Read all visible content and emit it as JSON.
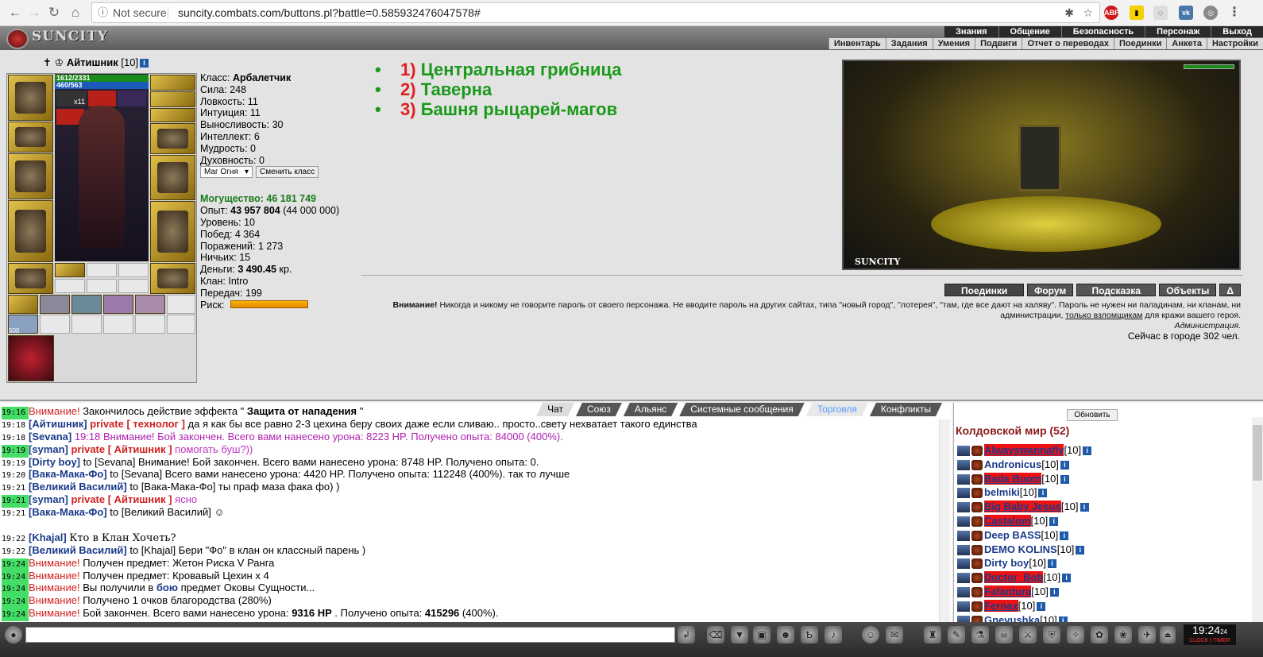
{
  "browser": {
    "not_secure": "Not secure",
    "url": "suncity.combats.com/buttons.pl?battle=0.585932476047578#"
  },
  "header": {
    "logo": "SUNCITY",
    "top_menu": [
      "Знания",
      "Общение",
      "Безопасность",
      "Персонаж",
      "Выход"
    ],
    "sub_menu": [
      "Инвентарь",
      "Задания",
      "Умения",
      "Подвиги",
      "Отчет о переводах",
      "Поединки",
      "Анкета",
      "Настройки"
    ]
  },
  "character": {
    "name": "Айтишник",
    "level": "[10]",
    "info_icon": "i",
    "hp": "1612/2331",
    "mana": "460/563",
    "buff_count": "x11",
    "slot_count": "500"
  },
  "stats": {
    "class_label": "Класс:",
    "class_value": "Арбалетчик",
    "lines": [
      "Сила: 248",
      "Ловкость: 11",
      "Интуиция: 11",
      "Выносливость: 30",
      "Интеллект: 6",
      "Мудрость: 0",
      "Духовность: 0"
    ],
    "class_select": "Маг Огня",
    "change_class": "Сменить класс",
    "power_label": "Могущество:",
    "power_value": "46 181 749",
    "exp_label": "Опыт:",
    "exp_value": "43 957 804",
    "exp_next": "(44 000 000)",
    "level_line": "Уровень: 10",
    "wins": "Побед: 4 364",
    "losses": "Поражений: 1 273",
    "draws": "Ничьих: 15",
    "money_label": "Деньги:",
    "money_value": "3 490.45",
    "money_unit": "кр.",
    "clan": "Клан: Intro",
    "transfers": "Передач: 199",
    "risk": "Риск:"
  },
  "locations": [
    {
      "num": "1)",
      "name": "Центральная грибница"
    },
    {
      "num": "2)",
      "name": "Таверна"
    },
    {
      "num": "3)",
      "name": "Башня рыцарей-магов"
    }
  ],
  "scene_label": "SUNCITY",
  "action_tabs": [
    "Поединки",
    "Форум",
    "Подсказка",
    "Объекты",
    "Δ"
  ],
  "warning": {
    "bold": "Внимание!",
    "text1": " Никогда и никому не говорите пароль от своего персонажа. Не вводите пароль на других сайтах, типа \"новый город\", \"лотерея\", \"там, где все дают на халяву\". Пароль не нужен ни паладинам, ни кланам, ни администрации, ",
    "link": "только взломщикам",
    "text2": " для кражи вашего героя.",
    "sign": "Администрация."
  },
  "online": "Сейчас в городе 302 чел.",
  "chat_tabs": [
    "Чат",
    "Союз",
    "Альянс",
    "Системные сообщения",
    "Торговля",
    "Конфликты"
  ],
  "chat": [
    {
      "t": "19:16",
      "g": true,
      "parts": [
        [
          "warn",
          "Внимание!"
        ],
        [
          "",
          "Закончилось действие эффекта \""
        ],
        [
          "b",
          "Защита от нападения"
        ],
        [
          "",
          "\""
        ]
      ]
    },
    {
      "t": "19:18",
      "g": false,
      "parts": [
        [
          "nm",
          "[Айтишник]"
        ],
        [
          "priv",
          " private [ технолог ]"
        ],
        [
          "",
          "да я как бы все равно 2-3 цехина беру своих даже если сливаю.. просто..свету нехватает такого единства"
        ]
      ]
    },
    {
      "t": "19:18",
      "g": false,
      "parts": [
        [
          "nm",
          "[Sevana]"
        ],
        [
          "sys",
          "19:18 Внимание! Бой закончен. Всего вами нанесено урона: 8223 HP. Получено опыта: 84000 (400%)."
        ]
      ]
    },
    {
      "t": "19:19",
      "g": true,
      "parts": [
        [
          "nm",
          "[syman]"
        ],
        [
          "priv",
          " private [ Айтишник ]"
        ],
        [
          "privtxt",
          "помогать буш?))"
        ]
      ]
    },
    {
      "t": "19:19",
      "g": false,
      "parts": [
        [
          "nm",
          "[Dirty boy]"
        ],
        [
          "",
          "to [Sevana] Внимание! Бой закончен. Всего вами нанесено урона: 8748 HP. Получено опыта: 0."
        ]
      ]
    },
    {
      "t": "19:20",
      "g": false,
      "parts": [
        [
          "nm",
          "[Вака-Мака-Фо]"
        ],
        [
          "",
          "to [Sevana] Всего вами нанесено урона: 4420 HP. Получено опыта: 112248 (400%). так то лучше"
        ]
      ]
    },
    {
      "t": "19:21",
      "g": false,
      "parts": [
        [
          "nm",
          "[Великий Василий]"
        ],
        [
          "",
          "to [Вака-Мака-Фо] ты праф маза фака фо) )"
        ]
      ]
    },
    {
      "t": "19:21",
      "g": true,
      "parts": [
        [
          "nm",
          "[syman]"
        ],
        [
          "priv",
          " private [ Айтишник ]"
        ],
        [
          "privtxt",
          "ясно"
        ]
      ]
    },
    {
      "t": "19:21",
      "g": false,
      "parts": [
        [
          "nm",
          "[Вака-Мака-Фо]"
        ],
        [
          "",
          "to [Великий Василий] ☺"
        ]
      ]
    },
    {
      "t": "",
      "g": false,
      "parts": [
        [
          "",
          ""
        ]
      ]
    },
    {
      "t": "19:22",
      "g": false,
      "parts": [
        [
          "nm",
          "[Khajal]"
        ],
        [
          "serif",
          "Кто в Клан Хочеть?"
        ]
      ]
    },
    {
      "t": "19:22",
      "g": false,
      "parts": [
        [
          "nm",
          "[Великий Василий]"
        ],
        [
          "",
          "to [Khajal] Бери \"Фо\" в клан он классный парень )"
        ]
      ]
    },
    {
      "t": "19:24",
      "g": true,
      "parts": [
        [
          "warn",
          "Внимание!"
        ],
        [
          "",
          "Получен предмет: Жетон Риска V Ранга"
        ]
      ]
    },
    {
      "t": "19:24",
      "g": true,
      "parts": [
        [
          "warn",
          "Внимание!"
        ],
        [
          "",
          "Получен предмет: Кровавый Цехин x 4"
        ]
      ]
    },
    {
      "t": "19:24",
      "g": true,
      "parts": [
        [
          "warn",
          "Внимание!"
        ],
        [
          "",
          "Вы получили в "
        ],
        [
          "nm",
          "бою"
        ],
        [
          "",
          "предмет Оковы Сущности..."
        ]
      ]
    },
    {
      "t": "19:24",
      "g": true,
      "parts": [
        [
          "warn",
          "Внимание!"
        ],
        [
          "",
          "Получено 1 очков благородства (280%)"
        ]
      ]
    },
    {
      "t": "19:24",
      "g": true,
      "parts": [
        [
          "warn",
          "Внимание!"
        ],
        [
          "",
          "Бой закончен. Всего вами нанесено урона: "
        ],
        [
          "b",
          "9316 HP"
        ],
        [
          "",
          ". Получено опыта: "
        ],
        [
          "b",
          "415296"
        ],
        [
          "",
          " (400%)."
        ]
      ]
    }
  ],
  "userlist": {
    "refresh": "Обновить",
    "world": "Колдовской мир (52)",
    "users": [
      {
        "name": "Alwayswannafly",
        "lvl": "[10]",
        "red": true
      },
      {
        "name": "Andronicus",
        "lvl": "[10]",
        "red": false
      },
      {
        "name": "Bada Boom",
        "lvl": "[10]",
        "red": true
      },
      {
        "name": "belmiki",
        "lvl": "[10]",
        "red": false
      },
      {
        "name": "Big Baby Jesus",
        "lvl": "[10]",
        "red": true
      },
      {
        "name": "Castalom",
        "lvl": "[10]",
        "red": true
      },
      {
        "name": "Deep BASS",
        "lvl": "[10]",
        "red": false
      },
      {
        "name": "DEMO KOLINS",
        "lvl": "[10]",
        "red": false
      },
      {
        "name": "Dirty boy",
        "lvl": "[10]",
        "red": false
      },
      {
        "name": "Doctor_Bob",
        "lvl": "[10]",
        "red": true
      },
      {
        "name": "Fafantura",
        "lvl": "[10]",
        "red": true
      },
      {
        "name": "Fernax",
        "lvl": "[10]",
        "red": true
      },
      {
        "name": "Gnevushka",
        "lvl": "[10]",
        "red": false
      }
    ]
  },
  "clock": {
    "time": "19:24",
    "sec": "24",
    "label": "CLOCK | TIMER"
  }
}
